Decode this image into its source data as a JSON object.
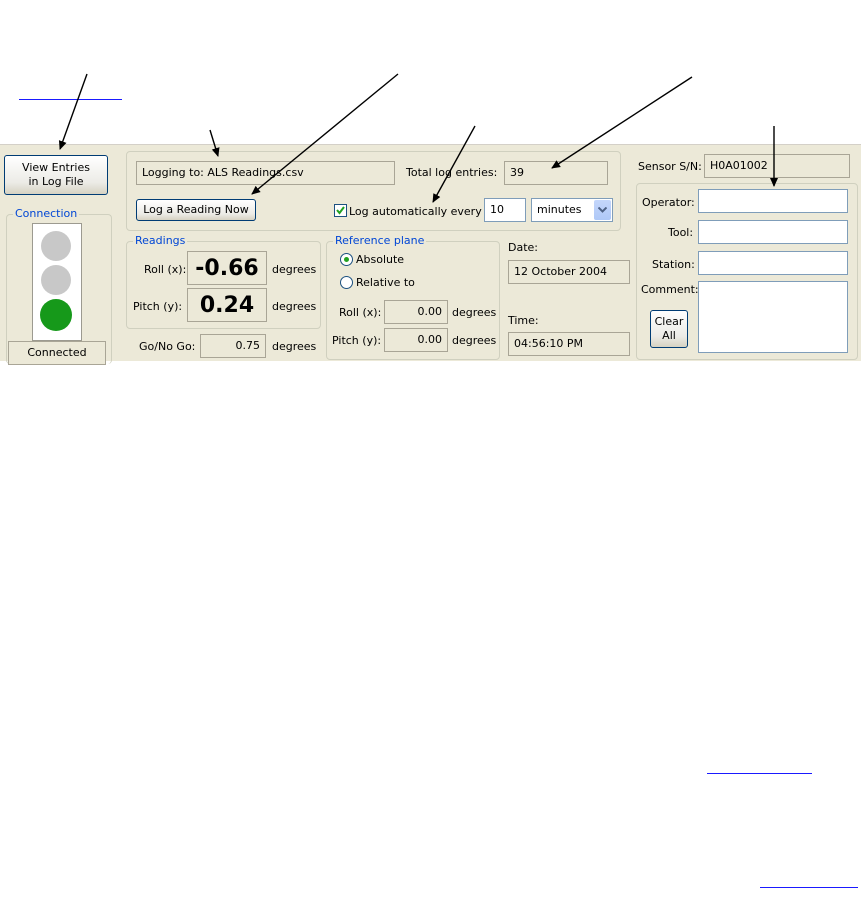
{
  "app": {
    "view_entries_button": "View Entries in Log File",
    "view_entries_line1": "View Entries",
    "view_entries_line2": "in Log File",
    "connection": {
      "title": "Connection",
      "lights": [
        "off",
        "off",
        "on-green"
      ],
      "status": "Connected"
    },
    "logging": {
      "file_text": "Logging to: ALS Readings.csv",
      "total_label": "Total log entries:",
      "total_value": "39",
      "log_now_button": "Log a Reading Now",
      "auto_label": "Log automatically every",
      "auto_checked": true,
      "interval_value": "10",
      "interval_unit": "minutes"
    },
    "readings": {
      "title": "Readings",
      "roll_label": "Roll (x):",
      "roll_value": "-0.66",
      "roll_unit": "degrees",
      "pitch_label": "Pitch (y):",
      "pitch_value": "0.24",
      "pitch_unit": "degrees",
      "gonogo_label": "Go/No Go:",
      "gonogo_value": "0.75",
      "gonogo_unit": "degrees"
    },
    "reference_plane": {
      "title": "Reference plane",
      "absolute_label": "Absolute",
      "relative_label": "Relative to",
      "selected": "Absolute",
      "roll_label": "Roll (x):",
      "roll_value": "0.00",
      "roll_unit": "degrees",
      "pitch_label": "Pitch (y):",
      "pitch_value": "0.00",
      "pitch_unit": "degrees"
    },
    "datetime": {
      "date_label": "Date:",
      "date_value": "12 October 2004",
      "time_label": "Time:",
      "time_value": "04:56:10 PM"
    },
    "sensor": {
      "sn_label": "Sensor S/N:",
      "sn_value": "H0A01002",
      "operator_label": "Operator:",
      "operator_value": "",
      "tool_label": "Tool:",
      "tool_value": "",
      "station_label": "Station:",
      "station_value": "",
      "comment_label": "Comment:",
      "comment_value": "",
      "clear_button": "Clear All",
      "clear_line1": "Clear",
      "clear_line2": "All"
    }
  },
  "colors": {
    "window_bg": "#ece9d8",
    "group_title": "#0046d5",
    "light_on": "#16991a",
    "light_off": "#c8c8c8",
    "link": "#1a1aff",
    "arrow": "#000000"
  }
}
